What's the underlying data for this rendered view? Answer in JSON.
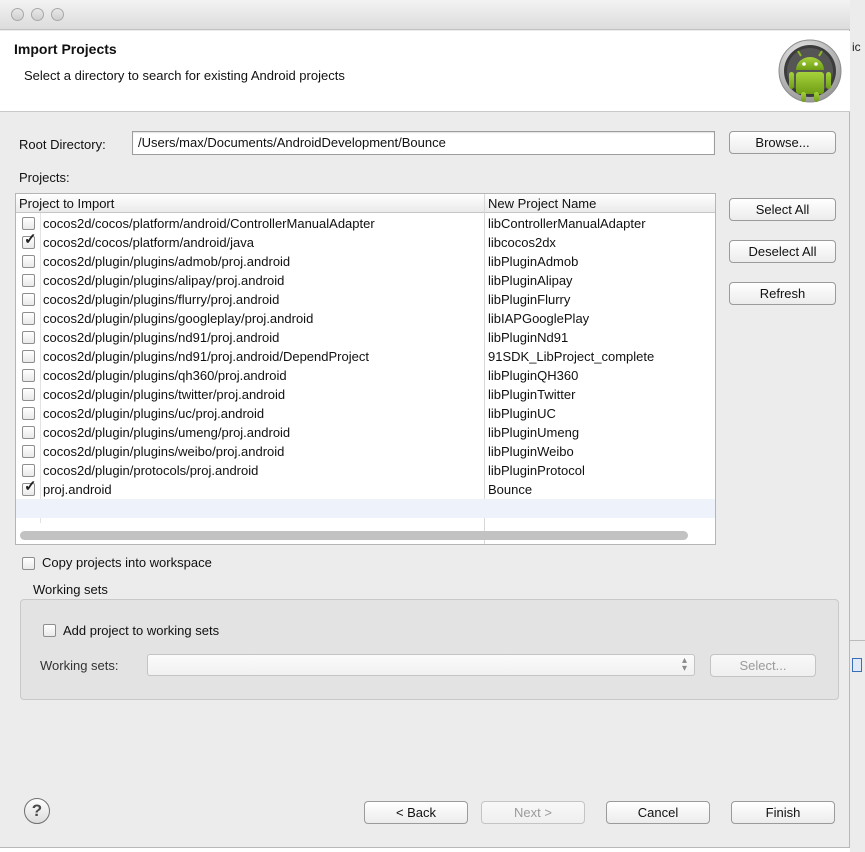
{
  "header": {
    "title": "Import Projects",
    "subtitle": "Select a directory to search for existing Android projects"
  },
  "root": {
    "label": "Root Directory:",
    "value": "/Users/max/Documents/AndroidDevelopment/Bounce",
    "browse": "Browse..."
  },
  "projects": {
    "label": "Projects:",
    "col1": "Project to Import",
    "col2": "New Project Name",
    "rows": [
      {
        "path": "cocos2d/cocos/platform/android/ControllerManualAdapter",
        "name": "libControllerManualAdapter",
        "checked": false
      },
      {
        "path": "cocos2d/cocos/platform/android/java",
        "name": "libcocos2dx",
        "checked": true
      },
      {
        "path": "cocos2d/plugin/plugins/admob/proj.android",
        "name": "libPluginAdmob",
        "checked": false
      },
      {
        "path": "cocos2d/plugin/plugins/alipay/proj.android",
        "name": "libPluginAlipay",
        "checked": false
      },
      {
        "path": "cocos2d/plugin/plugins/flurry/proj.android",
        "name": "libPluginFlurry",
        "checked": false
      },
      {
        "path": "cocos2d/plugin/plugins/googleplay/proj.android",
        "name": "libIAPGooglePlay",
        "checked": false
      },
      {
        "path": "cocos2d/plugin/plugins/nd91/proj.android",
        "name": "libPluginNd91",
        "checked": false
      },
      {
        "path": "cocos2d/plugin/plugins/nd91/proj.android/DependProject",
        "name": "91SDK_LibProject_complete",
        "checked": false
      },
      {
        "path": "cocos2d/plugin/plugins/qh360/proj.android",
        "name": "libPluginQH360",
        "checked": false
      },
      {
        "path": "cocos2d/plugin/plugins/twitter/proj.android",
        "name": "libPluginTwitter",
        "checked": false
      },
      {
        "path": "cocos2d/plugin/plugins/uc/proj.android",
        "name": "libPluginUC",
        "checked": false
      },
      {
        "path": "cocos2d/plugin/plugins/umeng/proj.android",
        "name": "libPluginUmeng",
        "checked": false
      },
      {
        "path": "cocos2d/plugin/plugins/weibo/proj.android",
        "name": "libPluginWeibo",
        "checked": false
      },
      {
        "path": "cocos2d/plugin/protocols/proj.android",
        "name": "libPluginProtocol",
        "checked": false
      },
      {
        "path": "proj.android",
        "name": "Bounce",
        "checked": true
      }
    ]
  },
  "side_buttons": {
    "select_all": "Select All",
    "deselect_all": "Deselect All",
    "refresh": "Refresh"
  },
  "copy_projects": {
    "label": "Copy projects into workspace",
    "checked": false
  },
  "working_sets": {
    "group_label": "Working sets",
    "add_label": "Add project to working sets",
    "add_checked": false,
    "field_label": "Working sets:",
    "select_button": "Select..."
  },
  "footer": {
    "help": "?",
    "back": "< Back",
    "next": "Next >",
    "cancel": "Cancel",
    "finish": "Finish"
  },
  "background": {
    "partial_text": "ic"
  }
}
